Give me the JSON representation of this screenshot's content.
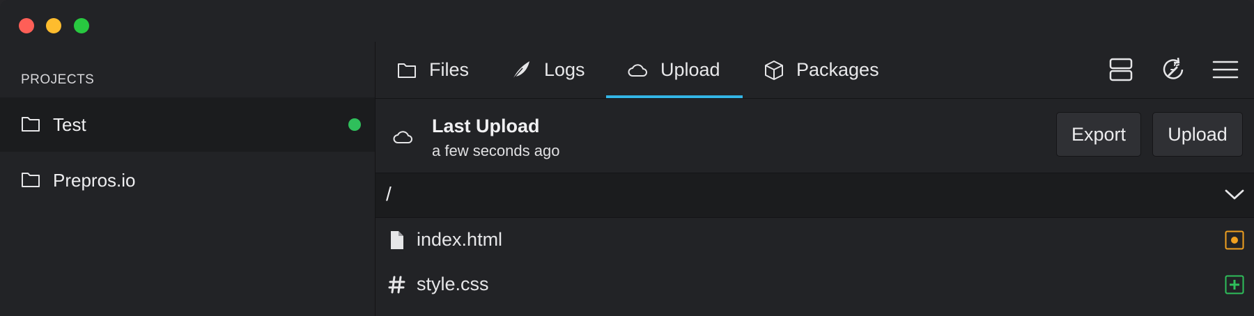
{
  "window": {
    "controls": [
      "close",
      "minimize",
      "zoom"
    ]
  },
  "sidebar": {
    "heading": "PROJECTS",
    "projects": [
      {
        "name": "Test",
        "icon": "folder-icon",
        "active": true,
        "status_color": "#2fbf5b"
      },
      {
        "name": "Prepros.io",
        "icon": "folder-icon",
        "active": false
      }
    ]
  },
  "tabs": [
    {
      "label": "Files",
      "icon": "folder-icon"
    },
    {
      "label": "Logs",
      "icon": "feather-icon"
    },
    {
      "label": "Upload",
      "icon": "cloud-icon",
      "active": true
    },
    {
      "label": "Packages",
      "icon": "package-icon"
    }
  ],
  "toolbar": {
    "icons": [
      "server-icon",
      "build-wand-icon",
      "menu-icon"
    ]
  },
  "upload": {
    "title": "Last Upload",
    "subtitle": "a few seconds ago",
    "export_label": "Export",
    "upload_label": "Upload"
  },
  "path": {
    "current": "/",
    "expand_icon": "chevron-down-icon"
  },
  "files": [
    {
      "name": "index.html",
      "icon": "file-icon",
      "status": "modified",
      "status_color": "#f0a020"
    },
    {
      "name": "style.css",
      "icon": "hash-icon",
      "status": "added",
      "status_color": "#2fbf5b"
    }
  ],
  "colors": {
    "accent": "#33b5e5",
    "background": "#222326",
    "selected_row": "#1b1c1e"
  }
}
